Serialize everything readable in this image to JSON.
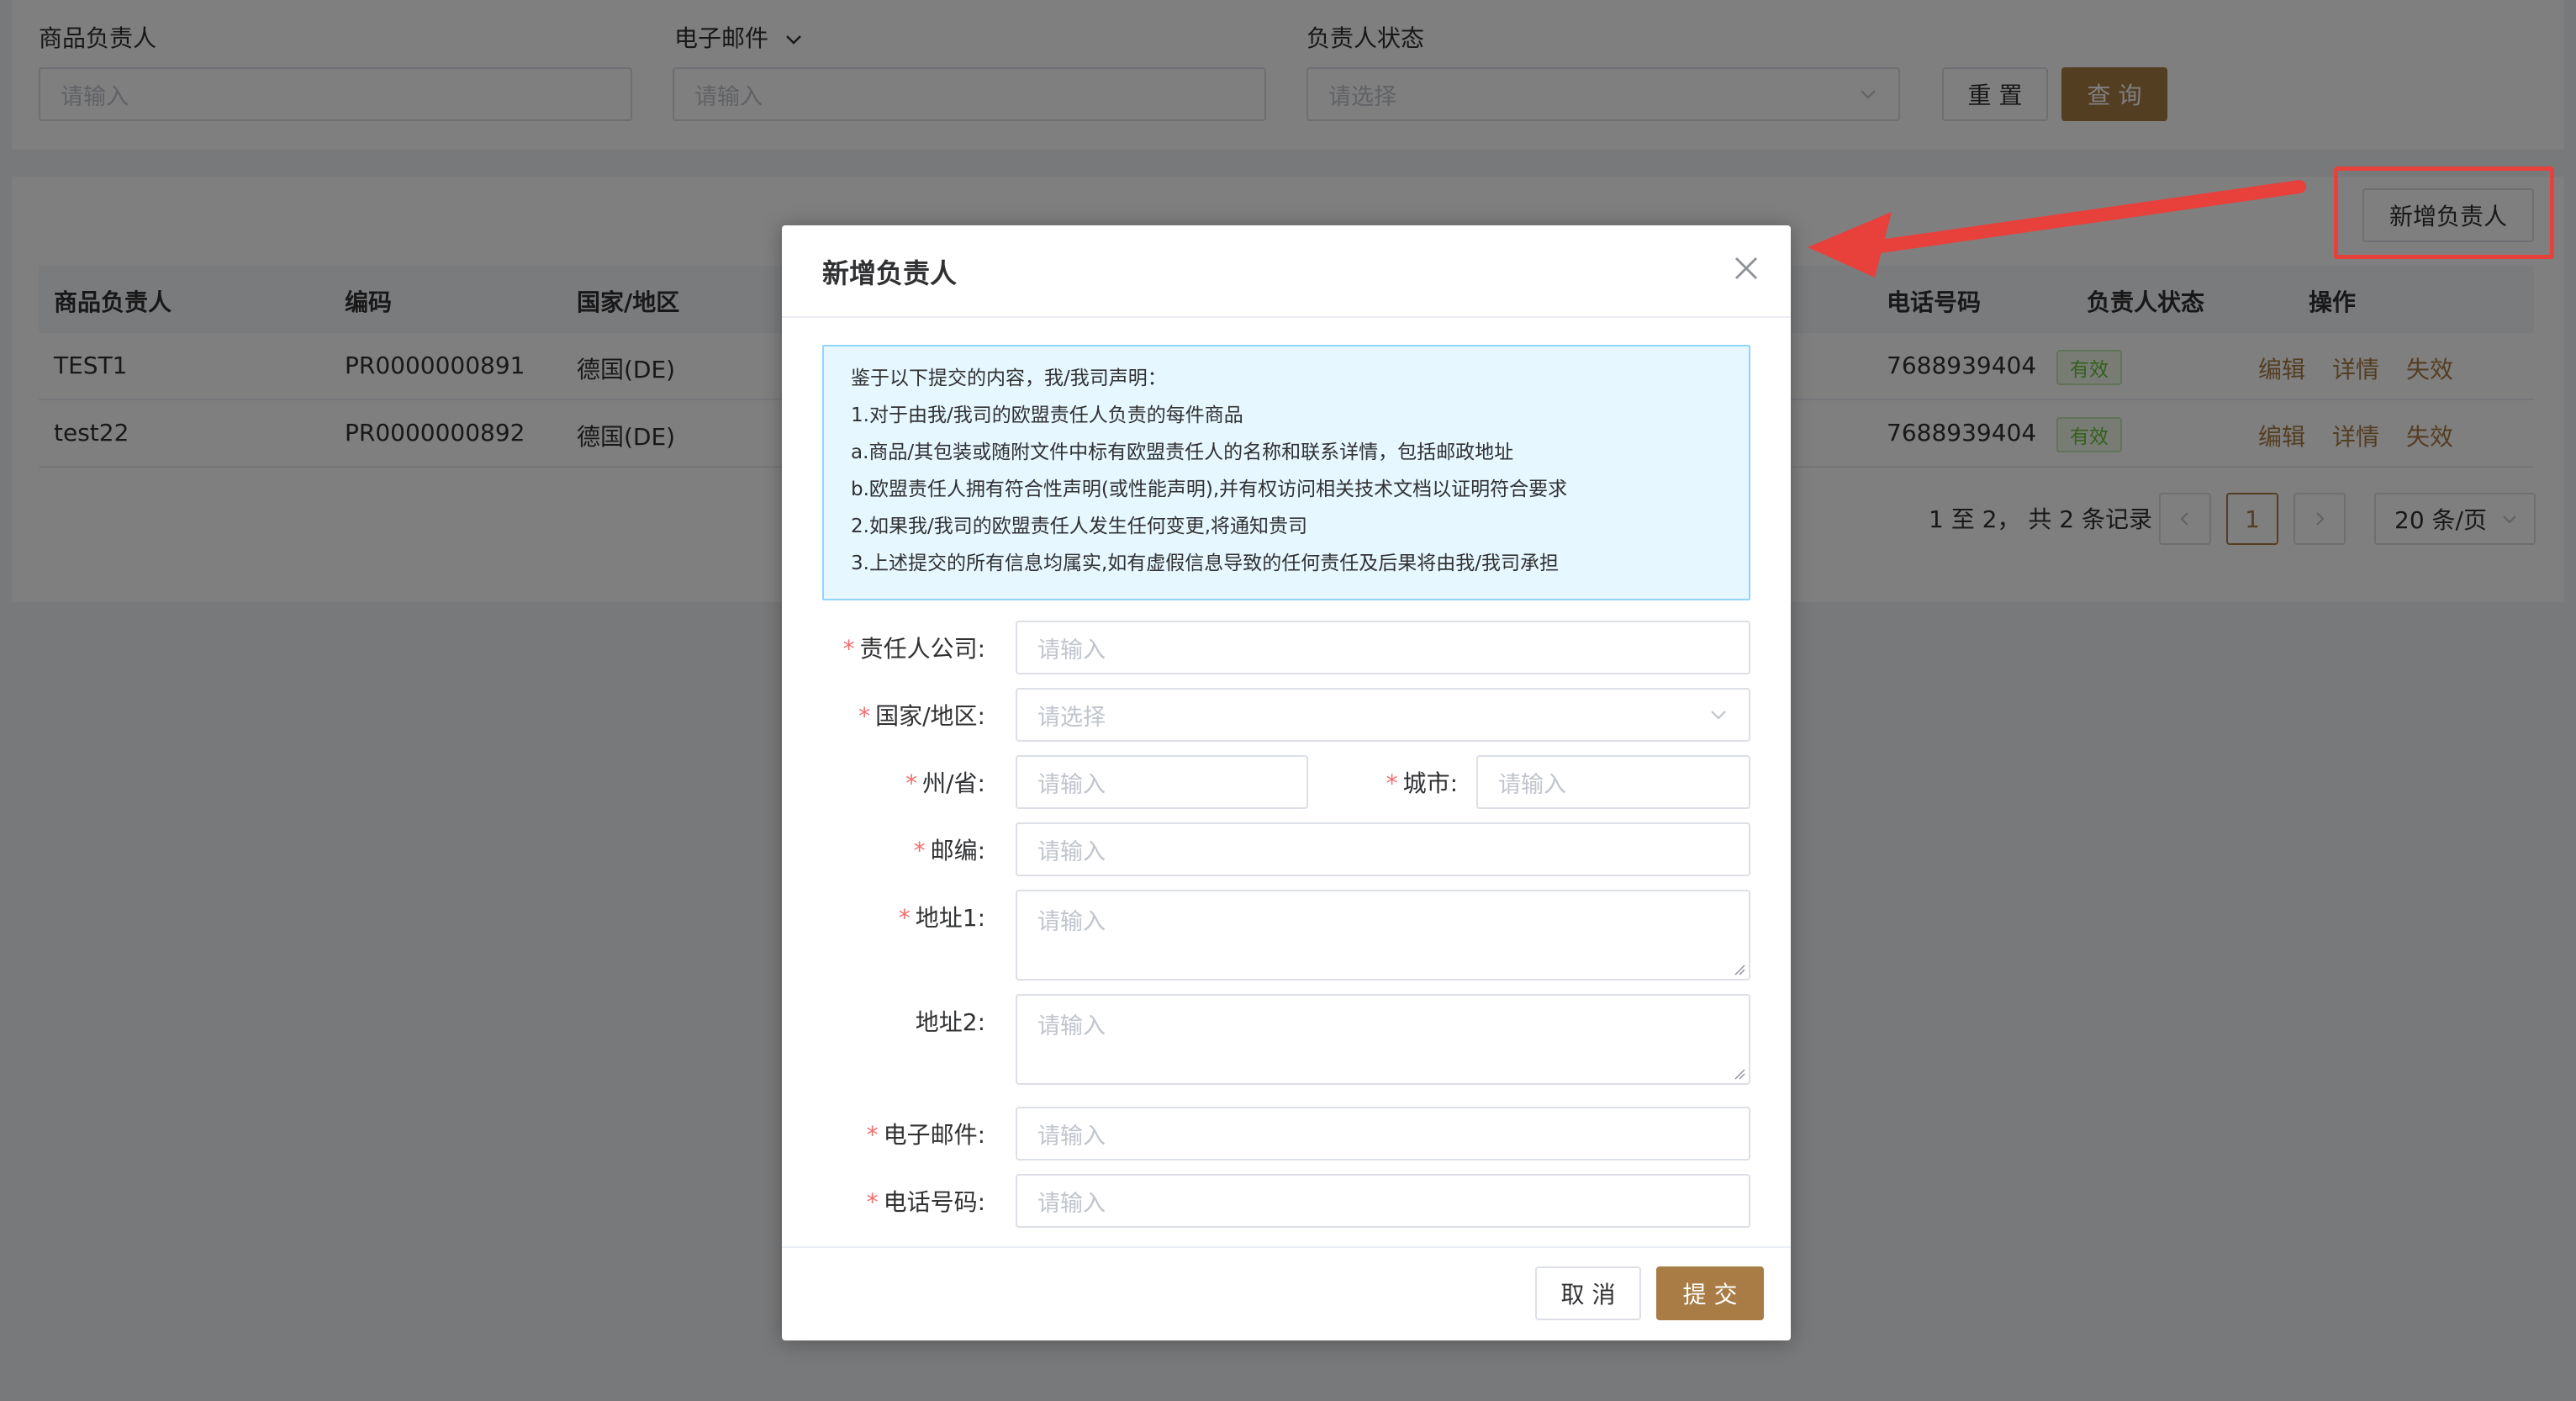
{
  "search": {
    "fields": [
      {
        "label": "商品负责人",
        "placeholder": "请输入"
      },
      {
        "label": "电子邮件",
        "placeholder": "请输入"
      },
      {
        "label": "负责人状态",
        "placeholder": "请选择"
      }
    ],
    "reset_label": "重 置",
    "query_label": "查 询"
  },
  "toolbar": {
    "add_label": "新增负责人"
  },
  "table": {
    "headers": [
      "商品负责人",
      "编码",
      "国家/地区",
      "电话号码",
      "负责人状态",
      "操作"
    ],
    "rows": [
      {
        "name": "TEST1",
        "code": "PR0000000891",
        "country": "德国(DE)",
        "phone": "7688939404",
        "status": "有效",
        "actions": [
          "编辑",
          "详情",
          "失效"
        ]
      },
      {
        "name": "test22",
        "code": "PR0000000892",
        "country": "德国(DE)",
        "phone": "7688939404",
        "status": "有效",
        "actions": [
          "编辑",
          "详情",
          "失效"
        ]
      }
    ]
  },
  "pagination": {
    "summary": "1 至 2，  共 2 条记录",
    "current_page": "1",
    "page_size": "20 条/页"
  },
  "dialog": {
    "title": "新增负责人",
    "notice": [
      "鉴于以下提交的内容，我/我司声明：",
      "1.对于由我/我司的欧盟责任人负责的每件商品",
      "a.商品/其包装或随附文件中标有欧盟责任人的名称和联系详情，包括邮政地址",
      "b.欧盟责任人拥有符合性声明(或性能声明),并有权访问相关技术文档以证明符合要求",
      "2.如果我/我司的欧盟责任人发生任何变更,将通知贵司",
      "3.上述提交的所有信息均属实,如有虚假信息导致的任何责任及后果将由我/我司承担"
    ],
    "form": {
      "company": {
        "label": "责任人公司:",
        "placeholder": "请输入"
      },
      "country": {
        "label": "国家/地区:",
        "placeholder": "请选择"
      },
      "state": {
        "label": "州/省:",
        "placeholder": "请输入"
      },
      "city": {
        "label": "城市:",
        "placeholder": "请输入"
      },
      "zip": {
        "label": "邮编:",
        "placeholder": "请输入"
      },
      "address1": {
        "label": "地址1:",
        "placeholder": "请输入"
      },
      "address2": {
        "label": "地址2:",
        "placeholder": "请输入"
      },
      "email": {
        "label": "电子邮件:",
        "placeholder": "请输入"
      },
      "phone": {
        "label": "电话号码:",
        "placeholder": "请输入"
      }
    },
    "cancel_label": "取 消",
    "submit_label": "提 交"
  },
  "colors": {
    "primary": "#a87c44",
    "annotation": "#e8413c",
    "required": "#f56c6c",
    "success": "#67c23a"
  }
}
